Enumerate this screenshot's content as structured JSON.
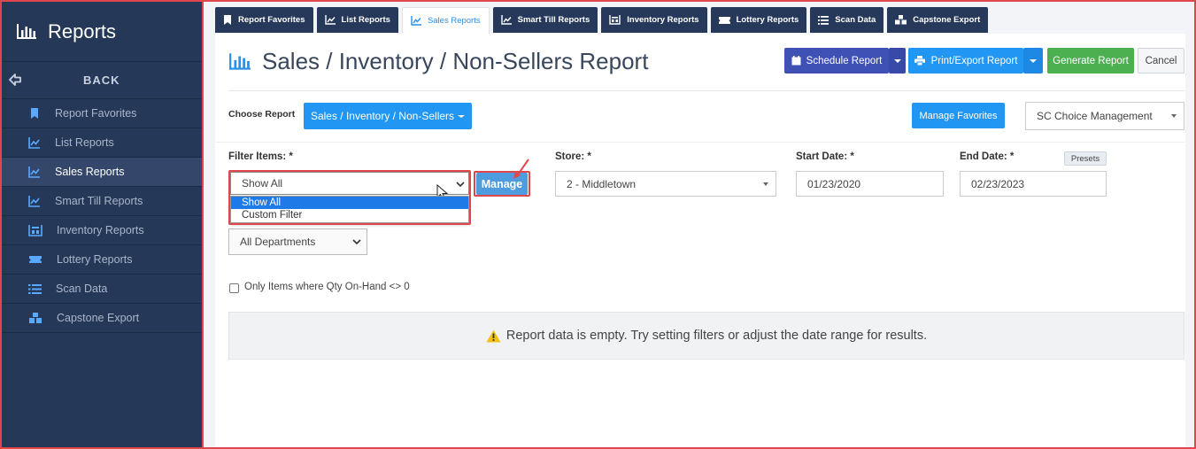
{
  "sidebar": {
    "title": "Reports",
    "back_label": "BACK",
    "items": [
      {
        "label": "Report Favorites",
        "icon": "bookmark-icon",
        "active": false
      },
      {
        "label": "List Reports",
        "icon": "chart-line-icon",
        "active": false
      },
      {
        "label": "Sales Reports",
        "icon": "chart-line-icon",
        "active": true
      },
      {
        "label": "Smart Till Reports",
        "icon": "chart-line-icon",
        "active": false
      },
      {
        "label": "Inventory Reports",
        "icon": "warehouse-icon",
        "active": false
      },
      {
        "label": "Lottery Reports",
        "icon": "ticket-icon",
        "active": false
      },
      {
        "label": "Scan Data",
        "icon": "list-icon",
        "active": false
      },
      {
        "label": "Capstone Export",
        "icon": "cubes-icon",
        "active": false
      }
    ]
  },
  "tabs": [
    {
      "label": "Report Favorites",
      "active": false
    },
    {
      "label": "List Reports",
      "active": false
    },
    {
      "label": "Sales Reports",
      "active": true
    },
    {
      "label": "Smart Till Reports",
      "active": false
    },
    {
      "label": "Inventory Reports",
      "active": false
    },
    {
      "label": "Lottery Reports",
      "active": false
    },
    {
      "label": "Scan Data",
      "active": false
    },
    {
      "label": "Capstone Export",
      "active": false
    }
  ],
  "header": {
    "title": "Sales / Inventory / Non-Sellers Report",
    "schedule_label": "Schedule Report",
    "print_label": "Print/Export Report",
    "generate_label": "Generate Report",
    "cancel_label": "Cancel"
  },
  "choose": {
    "label": "Choose Report",
    "selected": "Sales / Inventory / Non-Sellers",
    "manage_favorites_label": "Manage Favorites",
    "company": "SC Choice Management"
  },
  "filters": {
    "filter_items_label": "Filter Items: *",
    "filter_items_value": "Show All",
    "filter_items_options": [
      "Show All",
      "Custom Filter"
    ],
    "manage_label": "Manage",
    "store_label": "Store: *",
    "store_value": "2 - Middletown",
    "start_label": "Start Date: *",
    "start_value": "01/23/2020",
    "end_label": "End Date: *",
    "end_value": "02/23/2023",
    "presets_label": "Presets",
    "department_value": "All Departments",
    "qty_checkbox_label": "Only Items where Qty On-Hand <> 0"
  },
  "empty_message": "Report data is empty. Try setting filters or adjust the date range for results.",
  "colors": {
    "sidebar_bg": "#253858",
    "tab_bg": "#27395a",
    "primary": "#2196f3",
    "schedule": "#3f51b5",
    "generate": "#4caf50",
    "highlight": "#e0474c"
  }
}
